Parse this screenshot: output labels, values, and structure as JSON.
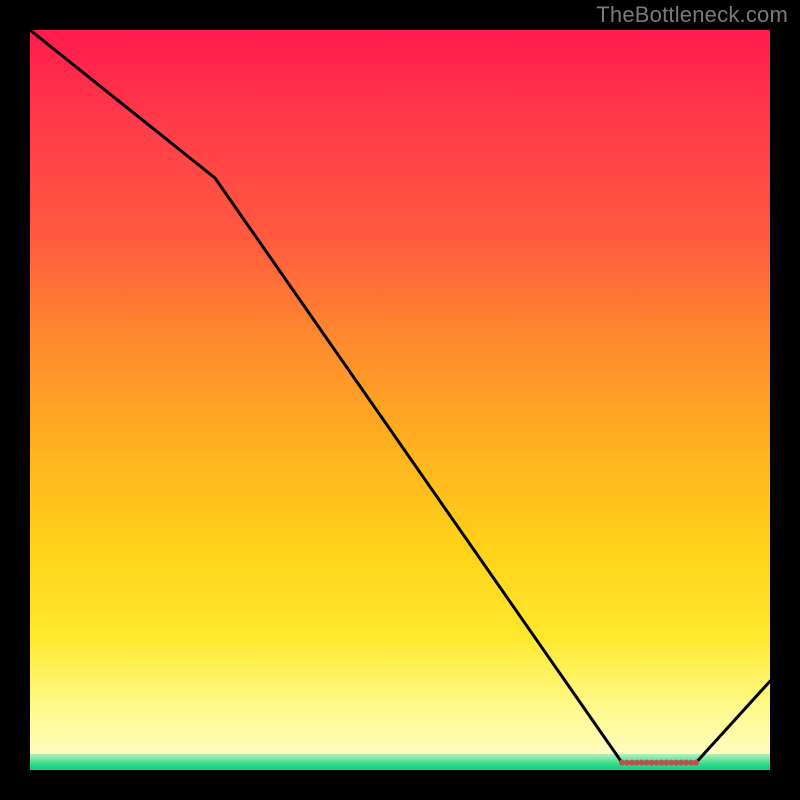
{
  "attribution": "TheBottleneck.com",
  "chart_data": {
    "type": "line",
    "title": "",
    "xlabel": "",
    "ylabel": "",
    "xlim": [
      0,
      100
    ],
    "ylim": [
      0,
      100
    ],
    "grid": false,
    "legend": false,
    "annotations": [],
    "series": [
      {
        "name": "bottleneck-curve",
        "x": [
          0,
          25,
          80,
          90,
          100
        ],
        "values": [
          100,
          80,
          1,
          1,
          12
        ]
      }
    ],
    "background": {
      "kind": "vertical-gradient",
      "stops": [
        {
          "pos": 0.0,
          "color": "#ff1a4d"
        },
        {
          "pos": 0.12,
          "color": "#ff3a4a"
        },
        {
          "pos": 0.28,
          "color": "#ff5a3f"
        },
        {
          "pos": 0.42,
          "color": "#ff8a2e"
        },
        {
          "pos": 0.56,
          "color": "#ffb020"
        },
        {
          "pos": 0.7,
          "color": "#ffd21a"
        },
        {
          "pos": 0.82,
          "color": "#ffe92e"
        },
        {
          "pos": 0.92,
          "color": "#fffb90"
        },
        {
          "pos": 0.98,
          "color": "#8cecb0"
        },
        {
          "pos": 1.0,
          "color": "#12d084"
        }
      ]
    },
    "markers": {
      "present": true,
      "color": "#b45454",
      "description": "dense-ticks-along-trough",
      "x_start": 80,
      "x_end": 90,
      "count": 16
    }
  }
}
